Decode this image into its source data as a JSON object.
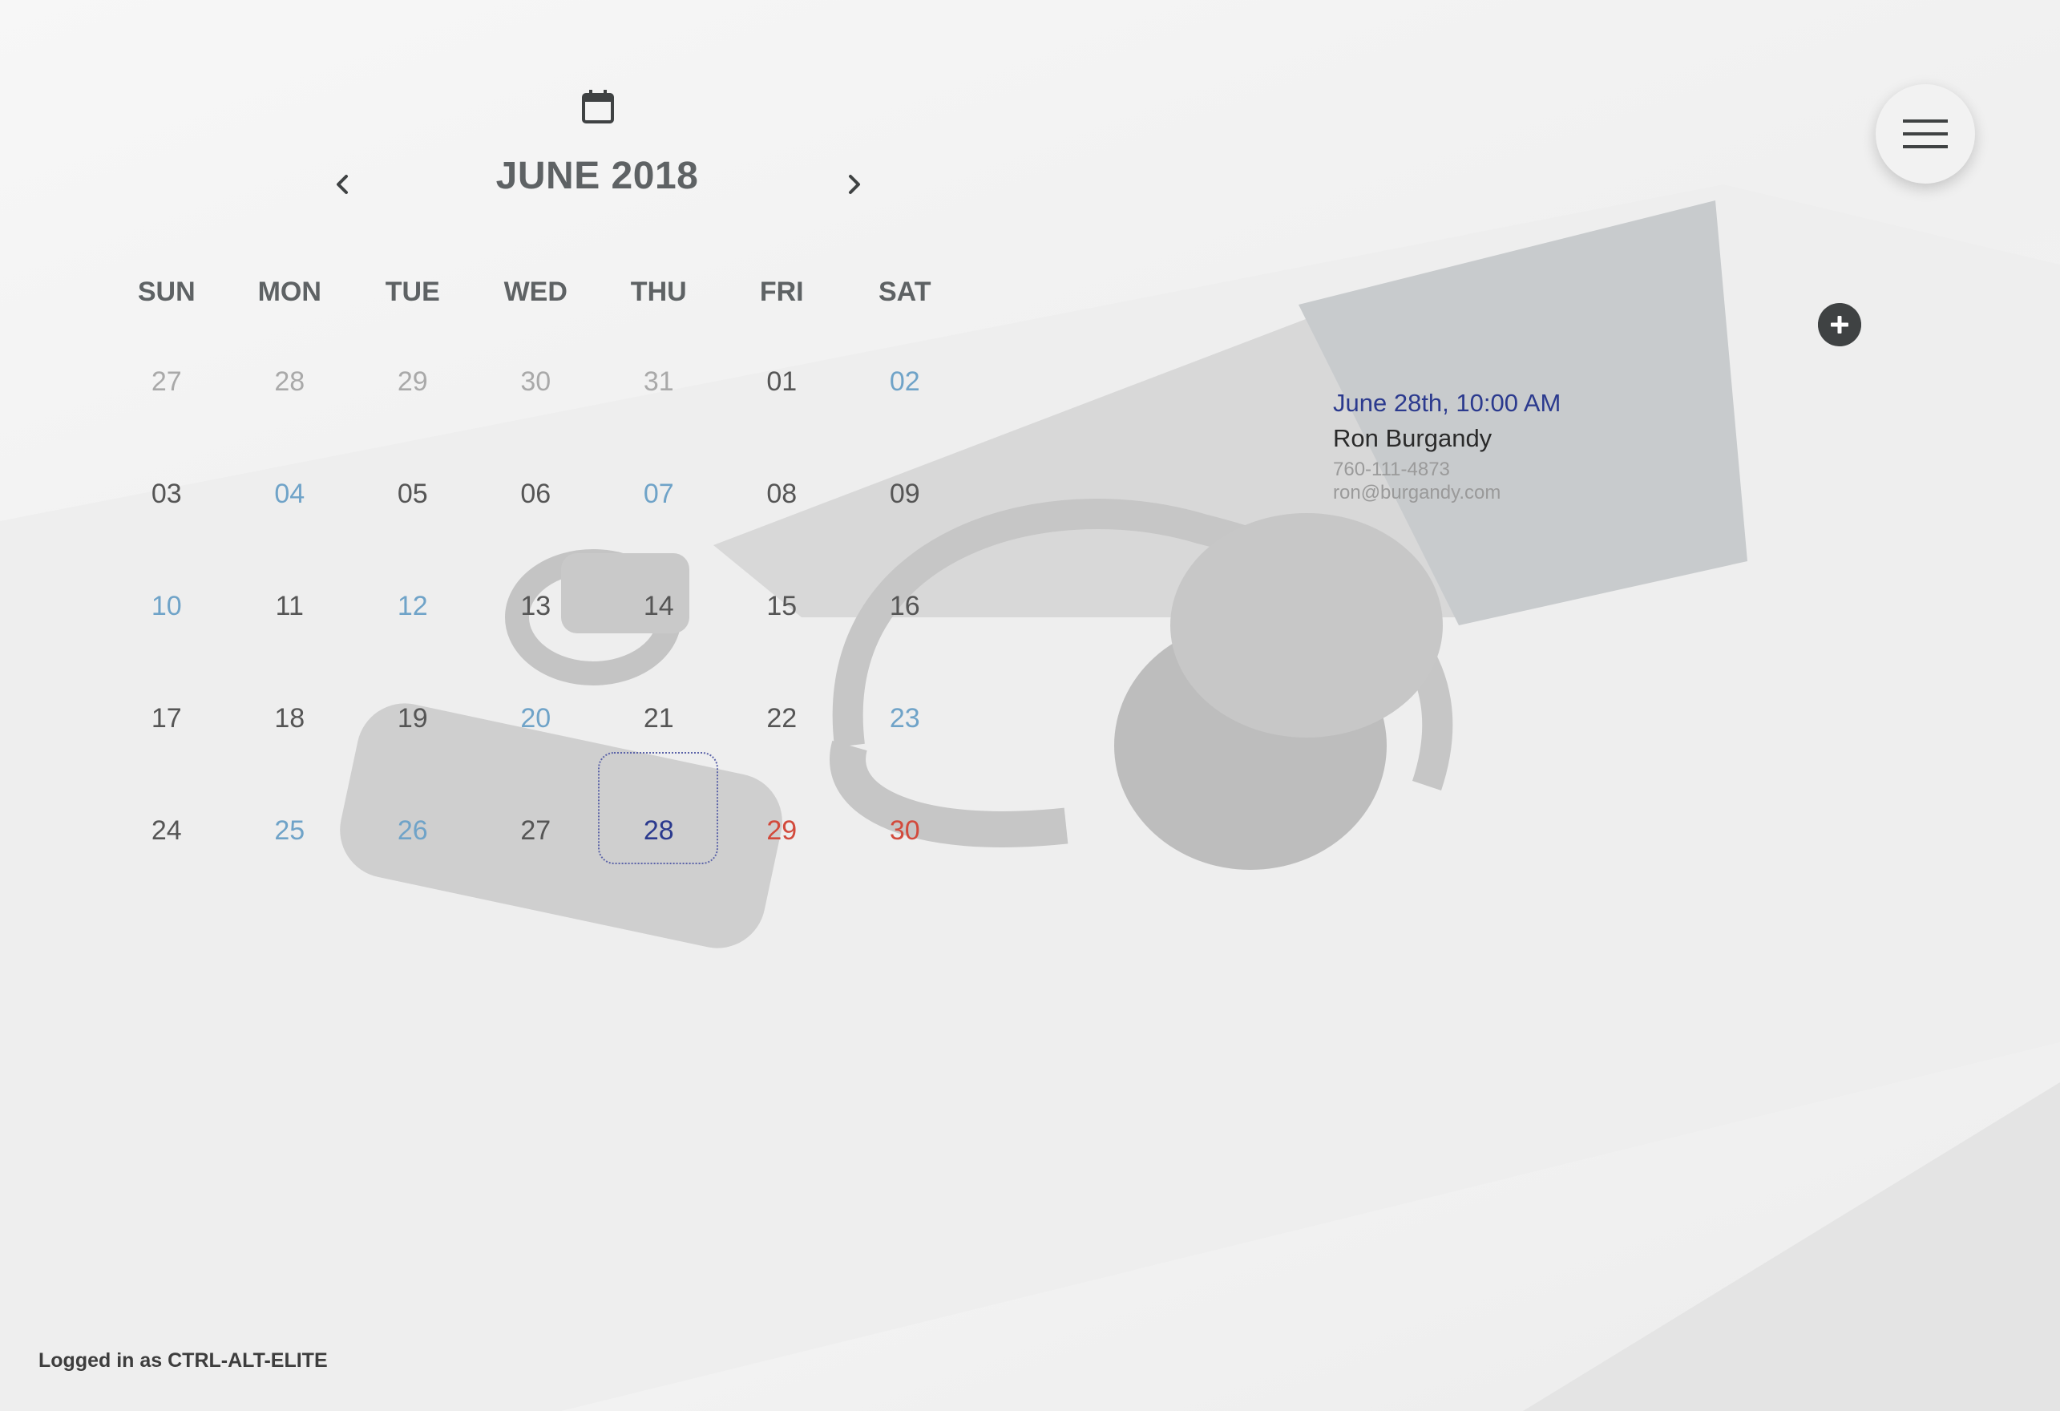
{
  "calendar": {
    "month_title": "JUNE 2018",
    "weekdays": [
      "SUN",
      "MON",
      "TUE",
      "WED",
      "THU",
      "FRI",
      "SAT"
    ],
    "weeks": [
      [
        "27",
        "28",
        "29",
        "30",
        "31",
        "01",
        "02"
      ],
      [
        "03",
        "04",
        "05",
        "06",
        "07",
        "08",
        "09"
      ],
      [
        "10",
        "11",
        "12",
        "13",
        "14",
        "15",
        "16"
      ],
      [
        "17",
        "18",
        "19",
        "20",
        "21",
        "22",
        "23"
      ],
      [
        "24",
        "25",
        "26",
        "27",
        "28",
        "29",
        "30"
      ]
    ]
  },
  "appointment": {
    "time": "June 28th, 10:00 AM",
    "name": "Ron Burgandy",
    "phone": "760-111-4873",
    "email": "ron@burgandy.com"
  },
  "footer": {
    "logged_in": "Logged in as CTRL-ALT-ELITE"
  },
  "icons": {
    "calendar": "calendar-icon",
    "prev": "chevron-left-icon",
    "next": "chevron-right-icon",
    "menu": "hamburger-menu-icon",
    "add": "plus-circle-icon"
  },
  "colors": {
    "text_dark": "#5e6264",
    "muted": "#a9a9a9",
    "event": "#6fa3c8",
    "selected": "#2b3a8e",
    "red": "#d24a3c"
  }
}
